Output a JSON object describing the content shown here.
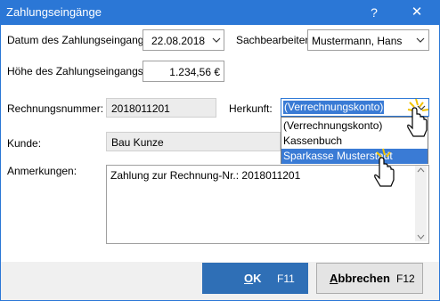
{
  "window": {
    "title": "Zahlungseingänge",
    "help_icon": "?",
    "close_icon": "✕"
  },
  "fields": {
    "date_label": "Datum des Zahlungseingangs:",
    "date_value": "22.08.2018",
    "clerk_label": "Sachbearbeiter:",
    "clerk_value": "Mustermann, Hans",
    "amount_label": "Höhe des Zahlungseingangs:",
    "amount_value": "1.234,56 €",
    "invoice_label": "Rechnungsnummer:",
    "invoice_value": "2018011201",
    "origin_label": "Herkunft:",
    "origin_value": "(Verrechnungskonto)",
    "customer_label": "Kunde:",
    "customer_value": "Bau Kunze",
    "notes_label": "Anmerkungen:",
    "notes_value": "Zahlung zur Rechnung-Nr.: 2018011201"
  },
  "dropdown": {
    "options": [
      "(Verrechnungskonto)",
      "Kassenbuch",
      "Sparkasse Musterstadt"
    ],
    "highlighted_option": "Sparkasse Musterstadt"
  },
  "buttons": {
    "ok_mnemonic": "O",
    "ok_rest": "K",
    "ok_key": "F11",
    "cancel_mnemonic": "A",
    "cancel_rest": "bbrechen",
    "cancel_key": "F12"
  },
  "colors": {
    "titlebar": "#2b77d6",
    "selection": "#3a7bd5",
    "ok_button": "#2f6fb6"
  }
}
